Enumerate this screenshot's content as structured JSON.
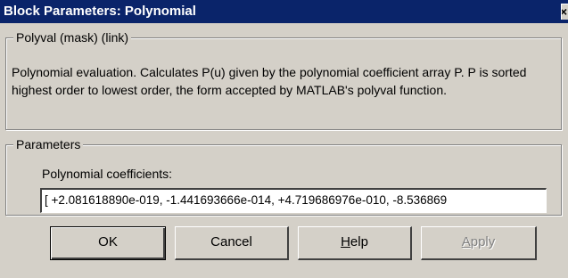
{
  "window": {
    "title": "Block Parameters: Polynomial",
    "close_glyph": "×"
  },
  "description_group": {
    "title": "Polyval (mask) (link)",
    "text": "Polynomial evaluation.  Calculates P(u) given by the polynomial coefficient array P.  P is sorted highest order to lowest order, the form accepted by MATLAB's polyval function."
  },
  "parameters_group": {
    "title": "Parameters",
    "coefficients_label": "Polynomial coefficients:",
    "coefficients_value": "[ +2.081618890e-019, -1.441693666e-014, +4.719686976e-010, -8.536869"
  },
  "buttons": {
    "ok": "OK",
    "cancel": "Cancel",
    "help_first": "H",
    "help_rest": "elp",
    "apply_first": "A",
    "apply_rest": "pply"
  },
  "colors": {
    "titlebar": "#0a246a",
    "dialog_face": "#d4d0c8",
    "disabled_text": "#808080"
  }
}
